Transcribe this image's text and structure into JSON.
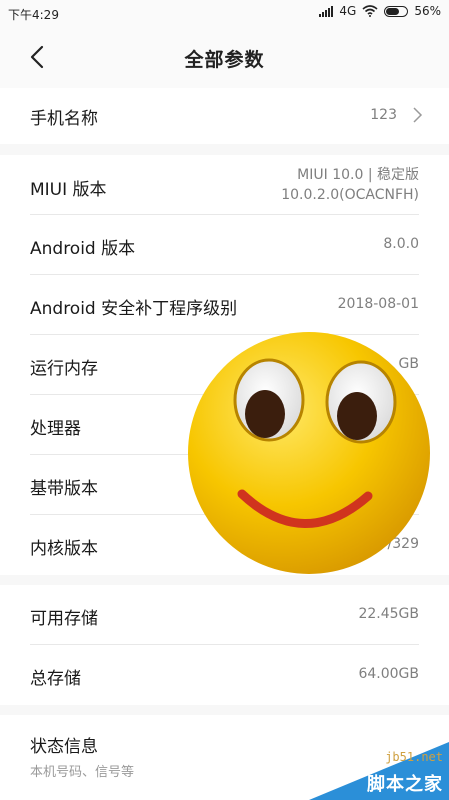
{
  "status_bar": {
    "time": "下午4:29",
    "network": "4G",
    "battery_percent": "56%",
    "battery_level": 0.56
  },
  "header": {
    "back_icon": "chevron-left-icon",
    "title": "全部参数"
  },
  "device_name": {
    "label": "手机名称",
    "value": "123"
  },
  "specs": [
    {
      "label": "MIUI 版本",
      "value_line1": "MIUI 10.0 | 稳定版",
      "value_line2": "10.0.2.0(OCACNFH)"
    },
    {
      "label": "Android 版本",
      "value": "8.0.0"
    },
    {
      "label": "Android 安全补丁程序级别",
      "value": "2018-08-01"
    },
    {
      "label": "运行内存",
      "value": "GB"
    },
    {
      "label": "处理器",
      "value": ""
    },
    {
      "label": "基带版本",
      "value": ""
    },
    {
      "label": "内核版本",
      "value": "/329"
    }
  ],
  "storage": [
    {
      "label": "可用存储",
      "value": "22.45GB"
    },
    {
      "label": "总存储",
      "value": "64.00GB"
    }
  ],
  "status_info": {
    "label": "状态信息",
    "sublabel": "本机号码、信号等"
  },
  "overlay": {
    "emoji": "smiley-face-icon"
  },
  "watermark": {
    "site": "jb51.net",
    "name": "脚本之家"
  },
  "colors": {
    "background": "#f7f7f7",
    "value_gray": "#7f7f7f",
    "emoji_yellow": "#f5c400",
    "watermark_blue": "#2b8fd8"
  }
}
